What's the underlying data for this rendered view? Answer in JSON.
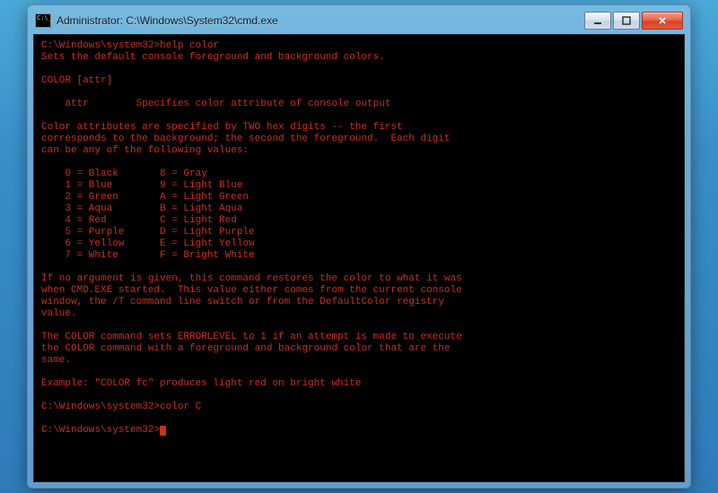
{
  "window": {
    "title": "Administrator: C:\\Windows\\System32\\cmd.exe"
  },
  "console": {
    "prompt": "C:\\Windows\\system32>",
    "cmd1": "help color",
    "cmd2": "color C",
    "help_intro": "Sets the default console foreground and background colors.",
    "syntax": "COLOR [attr]",
    "attr_label": "    attr        Specifies color attribute of console output",
    "spec1": "Color attributes are specified by TWO hex digits -- the first",
    "spec2": "corresponds to the background; the second the foreground.  Each digit",
    "spec3": "can be any of the following values:",
    "tbl0": "    0 = Black       8 = Gray",
    "tbl1": "    1 = Blue        9 = Light Blue",
    "tbl2": "    2 = Green       A = Light Green",
    "tbl3": "    3 = Aqua        B = Light Aqua",
    "tbl4": "    4 = Red         C = Light Red",
    "tbl5": "    5 = Purple      D = Light Purple",
    "tbl6": "    6 = Yellow      E = Light Yellow",
    "tbl7": "    7 = White       F = Bright White",
    "noarg1": "If no argument is given, this command restores the color to what it was",
    "noarg2": "when CMD.EXE started.  This value either comes from the current console",
    "noarg3": "window, the /T command line switch or from the DefaultColor registry",
    "noarg4": "value.",
    "err1": "The COLOR command sets ERRORLEVEL to 1 if an attempt is made to execute",
    "err2": "the COLOR command with a foreground and background color that are the",
    "err3": "same.",
    "example": "Example: \"COLOR fc\" produces light red on bright white"
  }
}
